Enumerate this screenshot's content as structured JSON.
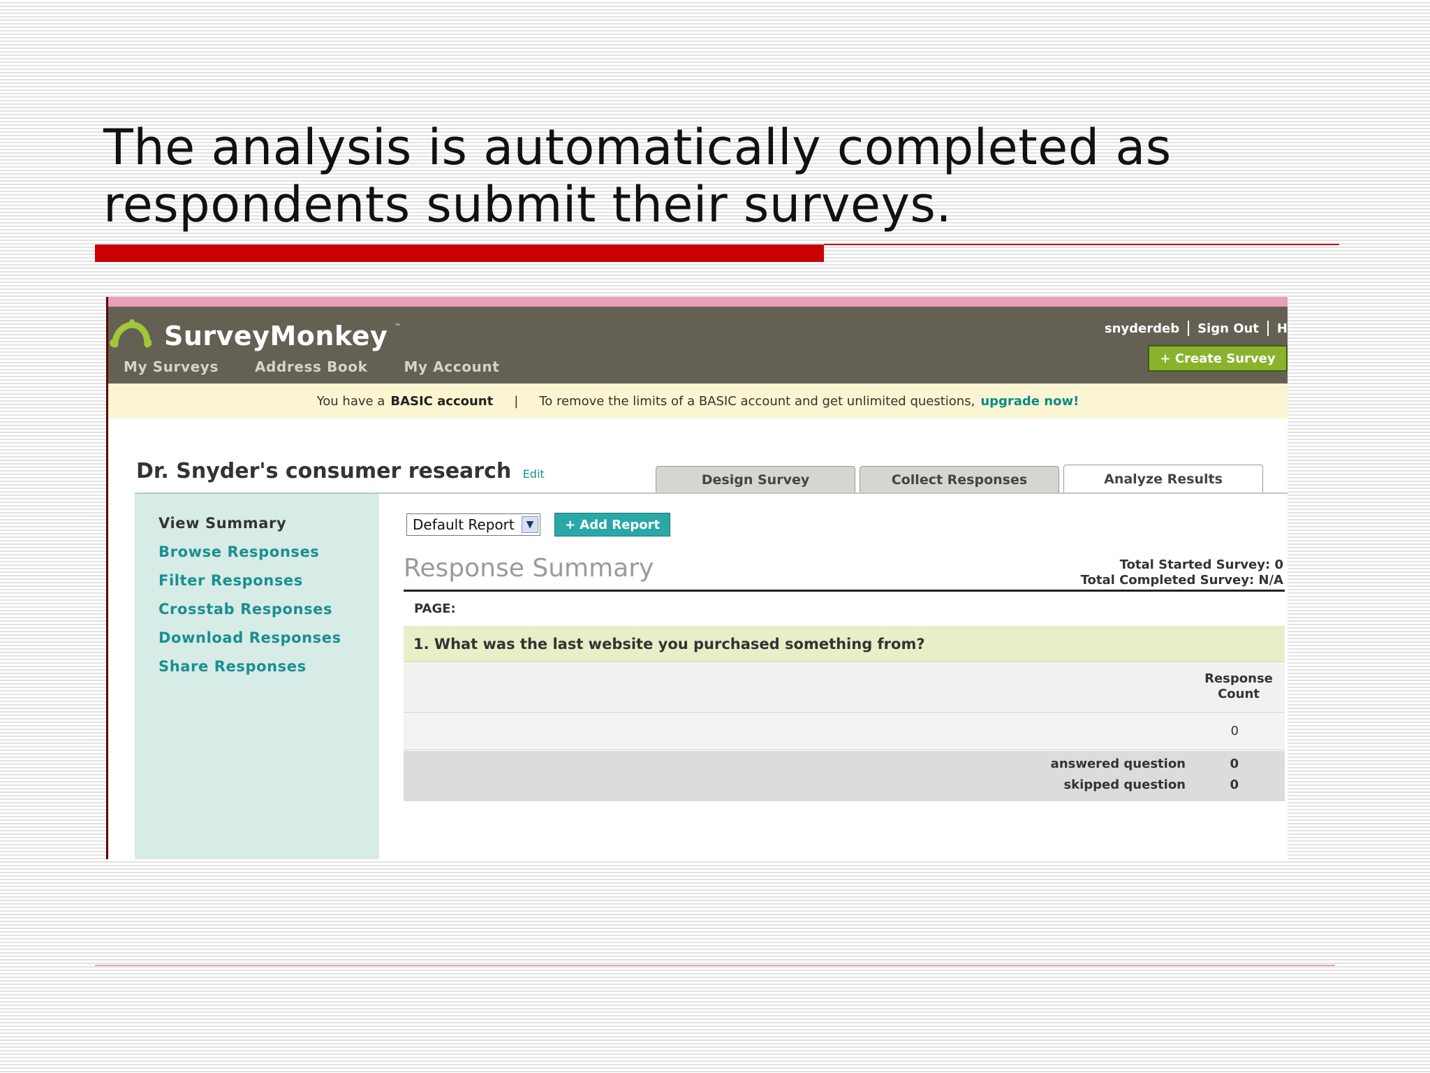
{
  "slide": {
    "title_line1": "The analysis is automatically completed as",
    "title_line2": "respondents submit their surveys."
  },
  "colors": {
    "accent_red": "#cc0000",
    "header_bg": "#646154",
    "sidebar_bg": "#d7ebe7",
    "link_teal": "#1a8f8f",
    "create_green": "#8ab32c"
  },
  "app": {
    "logo_text": "SurveyMonkey",
    "logo_tm": "™",
    "nav": [
      "My Surveys",
      "Address Book",
      "My Account"
    ],
    "user": {
      "username": "snyderdeb",
      "sign_out": "Sign Out",
      "help_partial": "H"
    },
    "create_button": "+ Create Survey"
  },
  "notice": {
    "prefix": "You have a",
    "account_type": "BASIC account",
    "separator": "|",
    "message": "To remove the limits of a BASIC account and get unlimited questions,",
    "upgrade_link": "upgrade now!"
  },
  "survey": {
    "title": "Dr. Snyder's consumer research",
    "edit_link": "Edit",
    "tabs": [
      {
        "label": "Design Survey",
        "active": false
      },
      {
        "label": "Collect Responses",
        "active": false
      },
      {
        "label": "Analyze Results",
        "active": true
      }
    ]
  },
  "sidebar": {
    "items": [
      {
        "label": "View Summary",
        "current": true
      },
      {
        "label": "Browse Responses",
        "current": false
      },
      {
        "label": "Filter Responses",
        "current": false
      },
      {
        "label": "Crosstab Responses",
        "current": false
      },
      {
        "label": "Download Responses",
        "current": false
      },
      {
        "label": "Share Responses",
        "current": false
      }
    ]
  },
  "report": {
    "select_value": "Default Report",
    "add_button": "+ Add Report",
    "heading": "Response Summary",
    "total_started": "Total Started Survey: 0",
    "total_completed": "Total Completed Survey: N/A",
    "page_label": "PAGE:"
  },
  "question": {
    "text": "1. What was the last website you purchased something from?",
    "column_header_line1": "Response",
    "column_header_line2": "Count",
    "row_count": "0",
    "answered_label": "answered question",
    "answered_value": "0",
    "skipped_label": "skipped question",
    "skipped_value": "0"
  }
}
